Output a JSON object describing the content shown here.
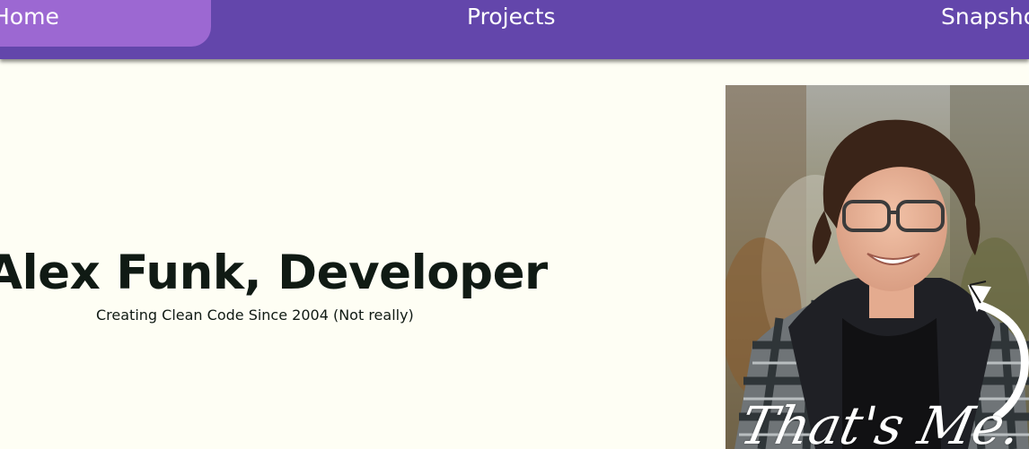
{
  "nav": {
    "home_label": "Home",
    "projects_label": "Projects",
    "snapshots_label": "Snapshots"
  },
  "hero": {
    "title": "Alex Funk, Developer",
    "subtitle": "Creating Clean Code Since 2004 (Not really)"
  },
  "photo": {
    "caption": "That's Me."
  },
  "colors": {
    "nav_bg": "#6346ab",
    "nav_active": "#9c68d2",
    "page_bg": "#fefef4",
    "text": "#101a14"
  }
}
